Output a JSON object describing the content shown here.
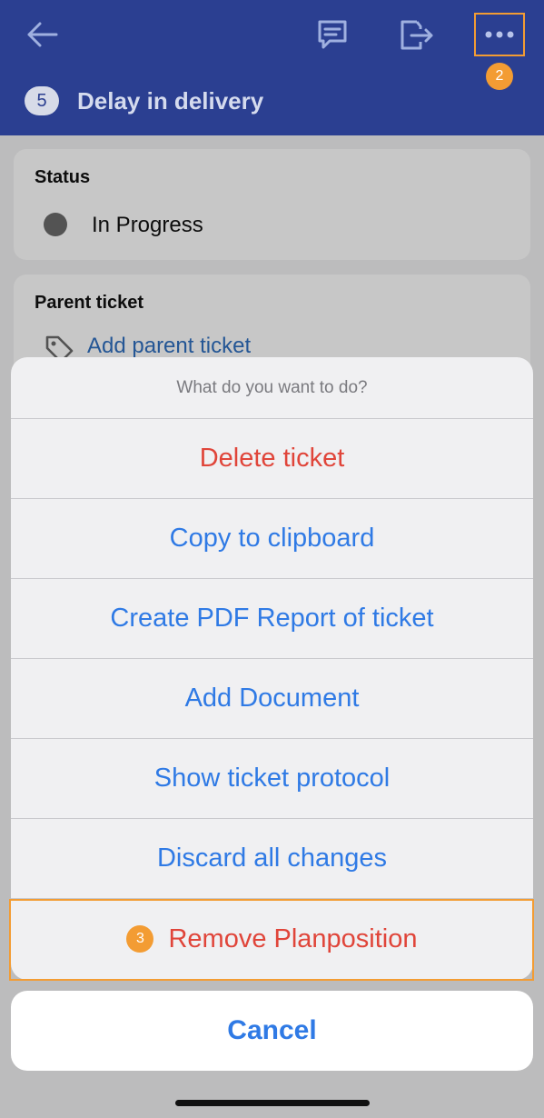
{
  "header": {
    "ticket_number": "5",
    "title": "Delay in delivery",
    "annotation_badge": "2",
    "bg_color": "#2b3f91"
  },
  "status_card": {
    "label": "Status",
    "value": "In Progress"
  },
  "parent_card": {
    "label": "Parent ticket",
    "link": "Add parent ticket"
  },
  "action_sheet": {
    "prompt": "What do you want to do?",
    "items": [
      {
        "label": "Delete ticket",
        "style": "destructive"
      },
      {
        "label": "Copy to clipboard",
        "style": "default"
      },
      {
        "label": "Create PDF Report of ticket",
        "style": "default"
      },
      {
        "label": "Add Document",
        "style": "default"
      },
      {
        "label": "Show ticket protocol",
        "style": "default"
      },
      {
        "label": "Discard all changes",
        "style": "default"
      },
      {
        "label": "Remove Planposition",
        "style": "destructive",
        "annotation_badge": "3"
      }
    ],
    "cancel": "Cancel"
  },
  "colors": {
    "accent": "#2f7ae5",
    "destructive": "#e0453a",
    "annotation": "#f39c33"
  },
  "icons": [
    "arrow-left-icon",
    "comment-icon",
    "export-icon",
    "more-icon",
    "tag-icon"
  ]
}
